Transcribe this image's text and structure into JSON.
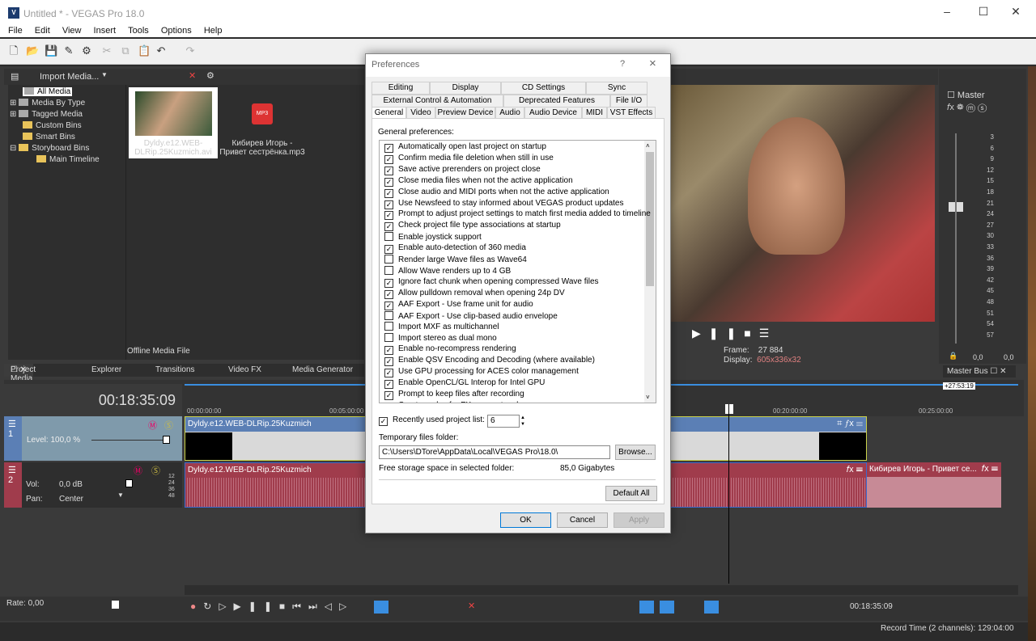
{
  "window": {
    "title": "Untitled * - VEGAS Pro 18.0",
    "logo": "V"
  },
  "menu": [
    "File",
    "Edit",
    "View",
    "Insert",
    "Tools",
    "Options",
    "Help"
  ],
  "project_media": {
    "import_label": "Import Media...",
    "tree": [
      "All Media",
      "Media By Type",
      "Tagged Media",
      "Custom Bins",
      "Smart Bins",
      "Storyboard Bins",
      "Main Timeline"
    ],
    "items": [
      {
        "name": "Dyldy.e12.WEB-DLRip.25Kuzmich.avi"
      },
      {
        "name": "Кибирев Игорь - Привет сестрёнка.mp3",
        "badge": "MP3"
      }
    ],
    "status": "Offline Media File"
  },
  "dock_tabs": [
    "Project Media",
    "Explorer",
    "Transitions",
    "Video FX",
    "Media Generator"
  ],
  "preview": {
    "frame_label": "Frame:",
    "frame": "27 884",
    "display_label": "Display:",
    "display": "605x336x32",
    "display_color": "#e08080"
  },
  "master_bus": {
    "title": "Master",
    "tab": "Master Bus",
    "scale": [
      "3",
      "6",
      "9",
      "12",
      "15",
      "18",
      "21",
      "24",
      "27",
      "30",
      "33",
      "36",
      "39",
      "42",
      "45",
      "48",
      "51",
      "54",
      "57"
    ],
    "left": "0,0",
    "right": "0,0"
  },
  "timeline": {
    "timecode": "00:18:35:09",
    "ruler": [
      "00:00:00:00",
      "00:05:00:00",
      "00:20:00:00",
      "00:25:00:00"
    ],
    "region": "+27:53:19",
    "tracks": [
      {
        "num": "1",
        "level_label": "Level:",
        "level": "100,0 %",
        "level_value": 100,
        "color": "#5b7fb5",
        "clip": "Dyldy.e12.WEB-DLRip.25Kuzmich"
      },
      {
        "num": "2",
        "vol_label": "Vol:",
        "vol": "0,0 dB",
        "pan_label": "Pan:",
        "pan": "Center",
        "color": "#a03c4c",
        "clip": "Dyldy.e12.WEB-DLRip.25Kuzmich",
        "clip2": "Кибирев Игорь - Привет се...",
        "db": [
          "12",
          "24",
          "36",
          "48"
        ]
      }
    ]
  },
  "transport": {
    "rate": "Rate: 0,00",
    "time": "00:18:35:09"
  },
  "status": {
    "record": "Record Time (2 channels): 129:04:00"
  },
  "dialog": {
    "title": "Preferences",
    "help": "?",
    "close": "×",
    "tabs_row1": [
      "Editing",
      "Display",
      "CD Settings",
      "Sync"
    ],
    "tabs_row2": [
      "External Control & Automation",
      "Deprecated Features",
      "File I/O"
    ],
    "tabs_row3": [
      "General",
      "Video",
      "Preview Device",
      "Audio",
      "Audio Device",
      "MIDI",
      "VST Effects"
    ],
    "selected_tab": "General",
    "section": "General preferences:",
    "options": [
      {
        "label": "Automatically open last project on startup",
        "checked": true
      },
      {
        "label": "Confirm media file deletion when still in use",
        "checked": true
      },
      {
        "label": "Save active prerenders on project close",
        "checked": true
      },
      {
        "label": "Close media files when not the active application",
        "checked": true
      },
      {
        "label": "Close audio and MIDI ports when not the active application",
        "checked": true
      },
      {
        "label": "Use Newsfeed to stay informed about VEGAS product updates",
        "checked": true
      },
      {
        "label": "Prompt to adjust project settings to match first media added to timeline",
        "checked": true
      },
      {
        "label": "Check project file type associations at startup",
        "checked": true
      },
      {
        "label": "Enable joystick support",
        "checked": false
      },
      {
        "label": "Enable auto-detection of 360 media",
        "checked": true
      },
      {
        "label": "Render large Wave files as Wave64",
        "checked": false
      },
      {
        "label": "Allow Wave renders up to 4 GB",
        "checked": false
      },
      {
        "label": "Ignore fact chunk when opening compressed Wave files",
        "checked": true
      },
      {
        "label": "Allow pulldown removal when opening 24p DV",
        "checked": true
      },
      {
        "label": "AAF Export - Use frame unit for audio",
        "checked": true
      },
      {
        "label": "AAF Export - Use clip-based audio envelope",
        "checked": false
      },
      {
        "label": "Import MXF as multichannel",
        "checked": false
      },
      {
        "label": "Import stereo as dual mono",
        "checked": false
      },
      {
        "label": "Enable no-recompress rendering",
        "checked": true
      },
      {
        "label": "Enable QSV Encoding and Decoding (where available)",
        "checked": true
      },
      {
        "label": "Use GPU processing for ACES color management",
        "checked": true
      },
      {
        "label": "Enable OpenCL/GL Interop for Intel GPU",
        "checked": true
      },
      {
        "label": "Prompt to keep files after recording",
        "checked": true
      },
      {
        "label": "Create undos for FX parameter changes",
        "checked": true
      }
    ],
    "recent_label": "Recently used project list:",
    "recent_checked": true,
    "recent_value": "6",
    "temp_label": "Temporary files folder:",
    "temp_value": "C:\\Users\\DTore\\AppData\\Local\\VEGAS Pro\\18.0\\",
    "browse": "Browse...",
    "free_label": "Free storage space in selected folder:",
    "free_value": "85,0 Gigabytes",
    "default_all": "Default All",
    "ok": "OK",
    "cancel": "Cancel",
    "apply": "Apply"
  }
}
